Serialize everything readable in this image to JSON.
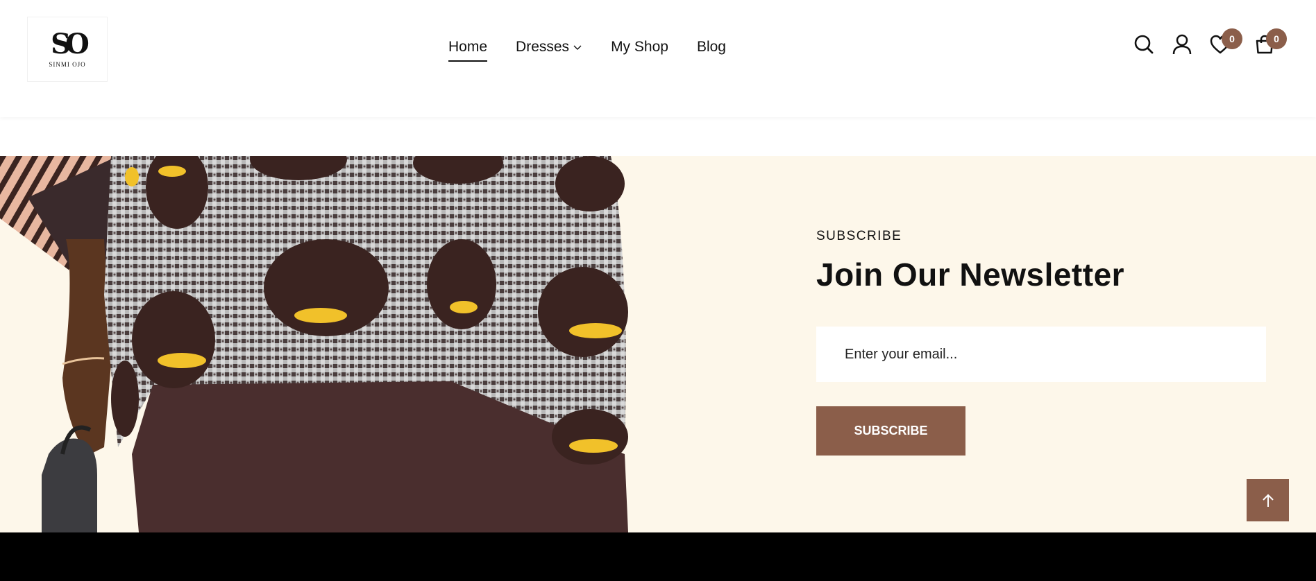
{
  "brand": {
    "mark": "SO",
    "name": "SINMI OJO"
  },
  "nav": {
    "items": [
      {
        "label": "Home",
        "active": true
      },
      {
        "label": "Dresses",
        "has_dropdown": true
      },
      {
        "label": "My Shop"
      },
      {
        "label": "Blog"
      }
    ]
  },
  "header_icons": {
    "search": "search-icon",
    "account": "user-icon",
    "wishlist": "heart-icon",
    "wishlist_count": "0",
    "cart": "shopping-bag-icon",
    "cart_count": "0"
  },
  "newsletter": {
    "label": "SUBSCRIBE",
    "title": "Join Our Newsletter",
    "email_placeholder": "Enter your email...",
    "button_label": "SUBSCRIBE"
  },
  "colors": {
    "accent": "#8b5e4a",
    "section_bg": "#fdf7ea",
    "footer_bg": "#000000"
  }
}
